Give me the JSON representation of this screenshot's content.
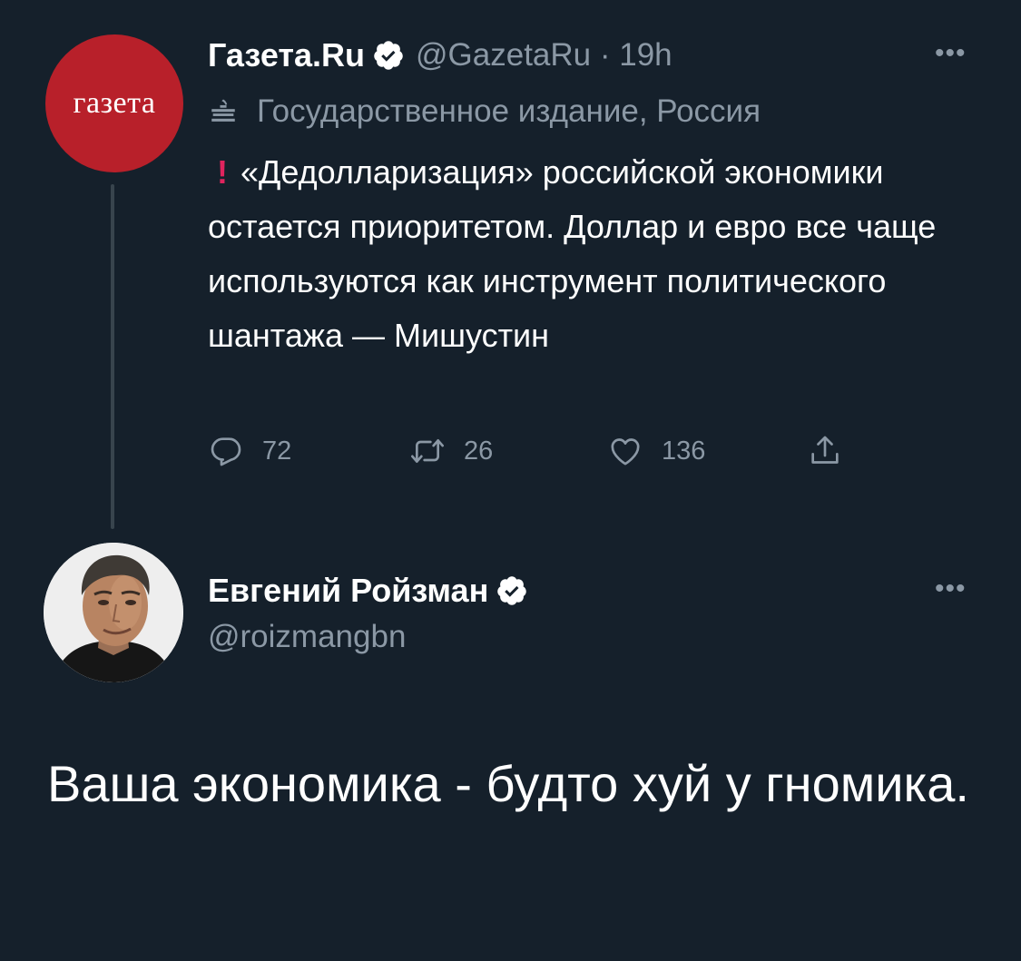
{
  "tweet1": {
    "avatar_text": "газета",
    "name": "Газета.Ru",
    "handle_time": "@GazetaRu · 19h",
    "label": "Государственное издание, Россия",
    "exclamation": "!",
    "text": "«Дедолларизация» российской экономики остается приоритетом. Доллар и евро все чаще используются как инструмент политического шантажа — Мишустин",
    "more": "•••",
    "actions": {
      "replies": "72",
      "retweets": "26",
      "likes": "136"
    }
  },
  "tweet2": {
    "name": "Евгений Ройзман",
    "handle": "@roizmangbn",
    "more": "•••",
    "text": "Ваша экономика - будто хуй у гномика."
  },
  "colors": {
    "background": "#15202b",
    "secondary_text": "#8b98a5",
    "verified_badge": "#ffffff",
    "gazeta_avatar": "#b8202a",
    "exclamation": "#e0245e"
  },
  "icons": {
    "verified": "verified-icon",
    "gov": "government-building-icon",
    "reply": "reply-icon",
    "retweet": "retweet-icon",
    "like": "heart-icon",
    "share": "share-icon",
    "more": "more-icon"
  }
}
